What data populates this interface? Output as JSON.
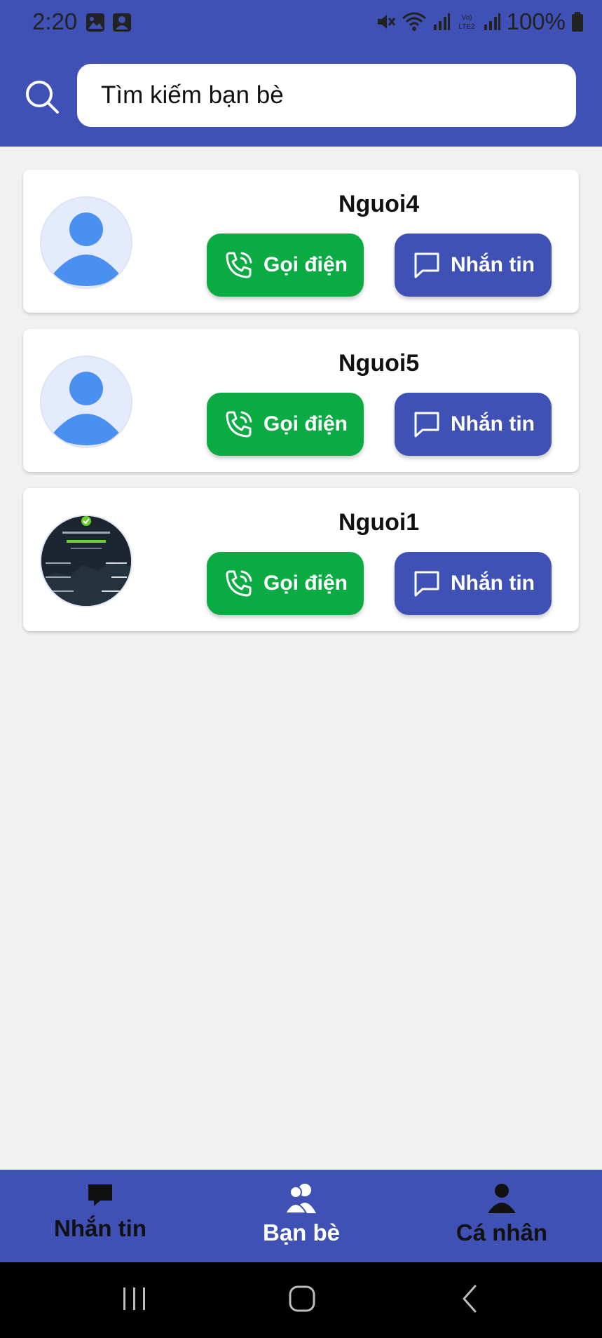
{
  "status_bar": {
    "time": "2:20",
    "battery": "100%",
    "icons": [
      "gallery-icon",
      "contact-icon",
      "mute-icon",
      "wifi-icon",
      "signal-icon",
      "volte-icon",
      "signal-icon",
      "battery-icon"
    ]
  },
  "search": {
    "placeholder": "Tìm kiếm bạn bè",
    "icon": "search-icon"
  },
  "friends": [
    {
      "name": "Nguoi4",
      "avatar": "default-avatar",
      "call_label": "Gọi điện",
      "message_label": "Nhắn tin"
    },
    {
      "name": "Nguoi5",
      "avatar": "default-avatar",
      "call_label": "Gọi điện",
      "message_label": "Nhắn tin"
    },
    {
      "name": "Nguoi1",
      "avatar": "photo-avatar",
      "call_label": "Gọi điện",
      "message_label": "Nhắn tin"
    }
  ],
  "bottom_nav": {
    "items": [
      {
        "label": "Nhắn tin",
        "icon": "chat-icon",
        "active": false
      },
      {
        "label": "Bạn bè",
        "icon": "friends-icon",
        "active": true
      },
      {
        "label": "Cá nhân",
        "icon": "person-icon",
        "active": false
      }
    ]
  },
  "colors": {
    "primary": "#3f51b5",
    "call_button": "#0bab44",
    "background": "#f1f1f1",
    "active_nav": "#ffffff"
  }
}
